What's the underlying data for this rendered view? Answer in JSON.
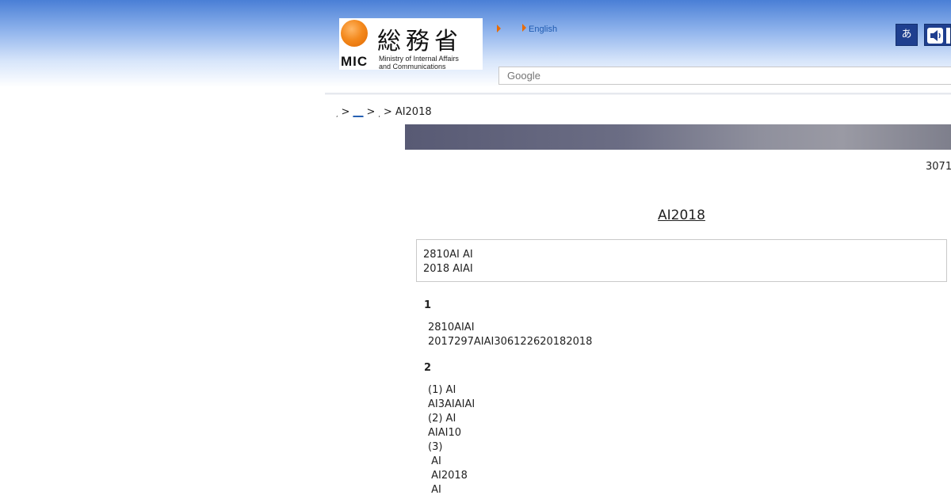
{
  "header": {
    "logo": {
      "kanji": "総務省",
      "abbr": "MIC",
      "subtitle_line1": "Ministry of Internal Affairs",
      "subtitle_line2": "and Communications"
    },
    "english_link": "English",
    "furigana_icon_label": "あ",
    "search_placeholder": "Google",
    "colors": {
      "accent": "#e86b00",
      "link": "#1f5bb0",
      "icon_bg": "#1f3f8f"
    }
  },
  "breadcrumb": {
    "link": "__",
    "current": "AI2018"
  },
  "date": "3071",
  "title": "AI2018",
  "summary": {
    "line1": "2810AI  AI",
    "line2": "2018 AIAI"
  },
  "sections": [
    {
      "heading": "1",
      "lines": [
        "2810AIAI",
        "2017297AIAI306122620182018"
      ]
    },
    {
      "heading": "2",
      "lines": [
        "(1) AI",
        "AI3AIAIAI",
        "(2) AI",
        "AIAI10",
        "(3)",
        " AI",
        " AI2018",
        " AI"
      ]
    }
  ]
}
